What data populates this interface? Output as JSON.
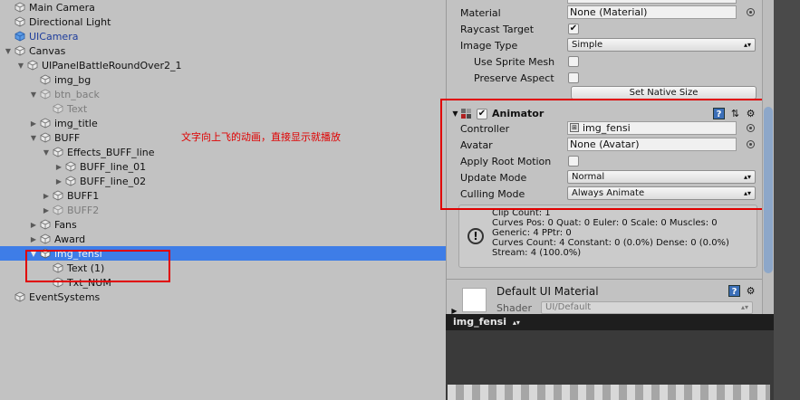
{
  "hierarchy": {
    "items": [
      {
        "label": "Main Camera",
        "fold": "none",
        "style": "normal",
        "icon": "gameobject-cube-icon"
      },
      {
        "label": "Directional Light",
        "fold": "none",
        "style": "normal",
        "icon": "gameobject-cube-icon"
      },
      {
        "label": "UICamera",
        "fold": "none",
        "style": "blue",
        "icon": "prefab-cube-icon"
      },
      {
        "label": "Canvas",
        "fold": "open",
        "style": "normal",
        "icon": "gameobject-cube-icon"
      },
      {
        "label": "UIPanelBattleRoundOver2_1",
        "fold": "open",
        "style": "normal",
        "icon": "gameobject-cube-icon"
      },
      {
        "label": "img_bg",
        "fold": "none",
        "style": "normal",
        "icon": "gameobject-cube-icon"
      },
      {
        "label": "btn_back",
        "fold": "open",
        "style": "dim",
        "icon": "gameobject-cube-icon"
      },
      {
        "label": "Text",
        "fold": "none",
        "style": "dim",
        "icon": "gameobject-cube-icon"
      },
      {
        "label": "img_title",
        "fold": "closed",
        "style": "normal",
        "icon": "gameobject-cube-icon"
      },
      {
        "label": "BUFF",
        "fold": "open",
        "style": "normal",
        "icon": "gameobject-cube-icon"
      },
      {
        "label": "Effects_BUFF_line",
        "fold": "open",
        "style": "normal",
        "icon": "gameobject-cube-icon"
      },
      {
        "label": "BUFF_line_01",
        "fold": "closed",
        "style": "normal",
        "icon": "gameobject-cube-icon"
      },
      {
        "label": "BUFF_line_02",
        "fold": "closed",
        "style": "normal",
        "icon": "gameobject-cube-icon"
      },
      {
        "label": "BUFF1",
        "fold": "closed",
        "style": "normal",
        "icon": "gameobject-cube-icon"
      },
      {
        "label": "BUFF2",
        "fold": "closed",
        "style": "dim",
        "icon": "gameobject-cube-icon"
      },
      {
        "label": "Fans",
        "fold": "closed",
        "style": "normal",
        "icon": "gameobject-cube-icon"
      },
      {
        "label": "Award",
        "fold": "closed",
        "style": "normal",
        "icon": "gameobject-cube-icon"
      },
      {
        "label": "img_fensi",
        "fold": "open",
        "style": "selected",
        "icon": "gameobject-cube-icon"
      },
      {
        "label": "Text (1)",
        "fold": "none",
        "style": "normal",
        "icon": "gameobject-cube-icon"
      },
      {
        "label": "Txt_NUM",
        "fold": "none",
        "style": "normal",
        "icon": "gameobject-cube-icon"
      },
      {
        "label": "EventSystems",
        "fold": "none",
        "style": "normal",
        "icon": "gameobject-cube-icon"
      }
    ],
    "annotation": "文字向上飞的动画，直接显示就播放"
  },
  "inspector": {
    "image": {
      "material_label": "Material",
      "material_value": "None (Material)",
      "raycast_label": "Raycast Target",
      "raycast_checked": "✔",
      "image_type_label": "Image Type",
      "image_type_value": "Simple",
      "use_sprite_mesh_label": "Use Sprite Mesh",
      "preserve_aspect_label": "Preserve Aspect",
      "set_native_size": "Set Native Size"
    },
    "animator": {
      "title": "Animator",
      "enabled": "✔",
      "controller_label": "Controller",
      "controller_value": "img_fensi",
      "avatar_label": "Avatar",
      "avatar_value": "None (Avatar)",
      "apply_root_motion_label": "Apply Root Motion",
      "update_mode_label": "Update Mode",
      "update_mode_value": "Normal",
      "culling_mode_label": "Culling Mode",
      "culling_mode_value": "Always Animate",
      "info_lines": [
        "Clip Count: 1",
        "Curves Pos: 0 Quat: 0 Euler: 0 Scale: 0 Muscles: 0",
        "Generic: 4 PPtr: 0",
        "Curves Count: 4 Constant: 0 (0.0%) Dense: 0 (0.0%)",
        "Stream: 4 (100.0%)"
      ]
    },
    "material": {
      "name": "Default UI Material",
      "shader_label": "Shader",
      "shader_value": "UI/Default"
    }
  },
  "preview": {
    "title": "img_fensi"
  },
  "colors": {
    "selection": "#3e7de7",
    "annotation_red": "#e00000",
    "panel_bg": "#c2c2c2"
  }
}
